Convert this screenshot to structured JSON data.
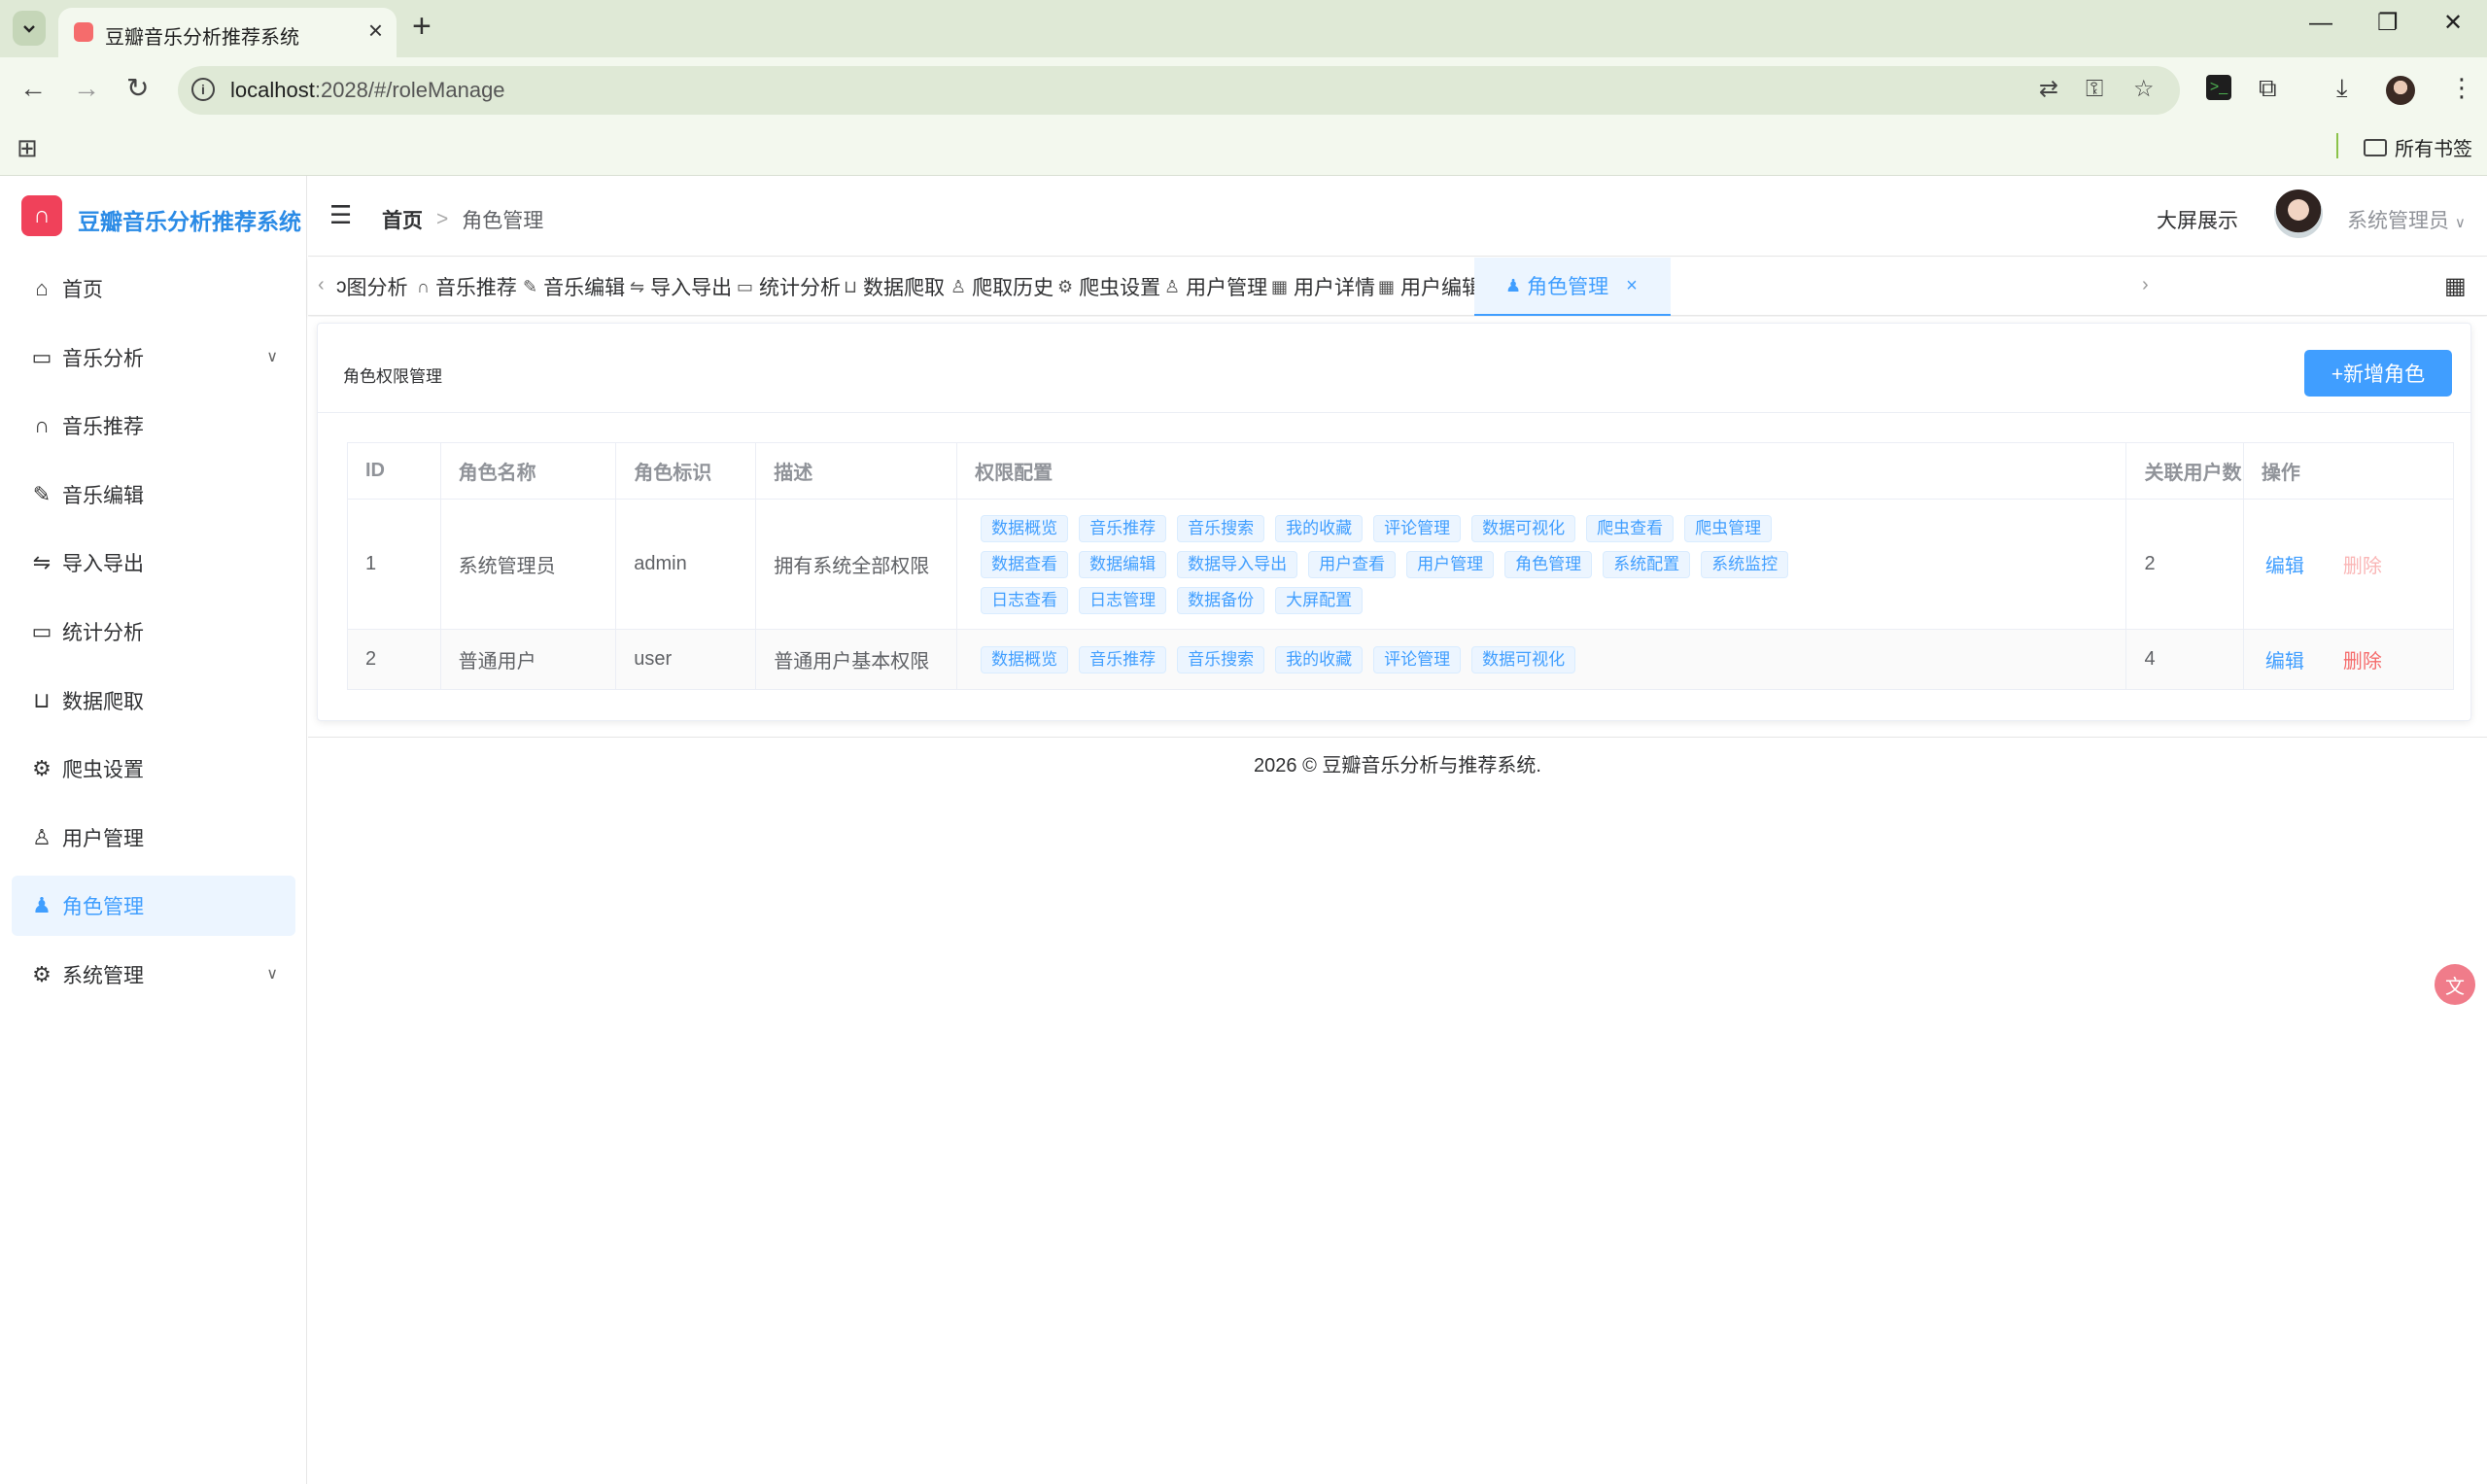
{
  "browser": {
    "tab_title": "豆瓣音乐分析推荐系统",
    "url_host": "localhost",
    "url_rest": ":2028/#/roleManage",
    "bookmarks_folder": "所有书签"
  },
  "app": {
    "logo_text": "豆瓣音乐分析推荐系统",
    "sidebar": {
      "items": [
        {
          "label": "首页",
          "icon": "home-icon"
        },
        {
          "label": "音乐分析",
          "icon": "chart-icon",
          "expandable": true
        },
        {
          "label": "音乐推荐",
          "icon": "headphones-icon"
        },
        {
          "label": "音乐编辑",
          "icon": "edit-icon"
        },
        {
          "label": "导入导出",
          "icon": "swap-icon"
        },
        {
          "label": "统计分析",
          "icon": "chart-icon"
        },
        {
          "label": "数据爬取",
          "icon": "basket-icon"
        },
        {
          "label": "爬虫设置",
          "icon": "gear-icon"
        },
        {
          "label": "用户管理",
          "icon": "user-icon"
        },
        {
          "label": "角色管理",
          "icon": "user-filled-icon",
          "active": true
        },
        {
          "label": "系统管理",
          "icon": "gear-icon",
          "expandable": true
        }
      ]
    },
    "header": {
      "breadcrumb_home": "首页",
      "breadcrumb_current": "角色管理",
      "big_screen": "大屏展示",
      "user_name": "系统管理员"
    },
    "tags": [
      {
        "label": "图分析",
        "icon": "",
        "prefix": "ɔ"
      },
      {
        "label": "音乐推荐",
        "icon": "headphones-icon"
      },
      {
        "label": "音乐编辑",
        "icon": "edit-icon"
      },
      {
        "label": "导入导出",
        "icon": "swap-icon"
      },
      {
        "label": "统计分析",
        "icon": "chart-icon"
      },
      {
        "label": "数据爬取",
        "icon": "basket-icon"
      },
      {
        "label": "爬取历史",
        "icon": "user-icon"
      },
      {
        "label": "爬虫设置",
        "icon": "gear-icon"
      },
      {
        "label": "用户管理",
        "icon": "user-icon"
      },
      {
        "label": "用户详情",
        "icon": "grid-icon"
      },
      {
        "label": "用户编辑",
        "icon": "grid-icon"
      },
      {
        "label": "角色管理",
        "icon": "user-filled-icon",
        "active": true
      }
    ],
    "card": {
      "title": "角色权限管理",
      "add_button": "+新增角色"
    },
    "table": {
      "headers": [
        "ID",
        "角色名称",
        "角色标识",
        "描述",
        "权限配置",
        "关联用户数",
        "操作"
      ],
      "rows": [
        {
          "id": "1",
          "name": "系统管理员",
          "key": "admin",
          "desc": "拥有系统全部权限",
          "perms": [
            "数据概览",
            "音乐推荐",
            "音乐搜索",
            "我的收藏",
            "评论管理",
            "数据可视化",
            "爬虫查看",
            "爬虫管理",
            "数据查看",
            "数据编辑",
            "数据导入导出",
            "用户查看",
            "用户管理",
            "角色管理",
            "系统配置",
            "系统监控",
            "日志查看",
            "日志管理",
            "数据备份",
            "大屏配置"
          ],
          "users": "2",
          "edit": "编辑",
          "delete": "删除",
          "delete_disabled": true
        },
        {
          "id": "2",
          "name": "普通用户",
          "key": "user",
          "desc": "普通用户基本权限",
          "perms": [
            "数据概览",
            "音乐推荐",
            "音乐搜索",
            "我的收藏",
            "评论管理",
            "数据可视化"
          ],
          "users": "4",
          "edit": "编辑",
          "delete": "删除",
          "delete_disabled": false
        }
      ]
    },
    "footer": "2026 © 豆瓣音乐分析与推荐系统."
  },
  "colors": {
    "primary": "#409eff",
    "danger": "#f56c6c",
    "logo": "#f0415a",
    "chrome": "#dfe9d6"
  }
}
